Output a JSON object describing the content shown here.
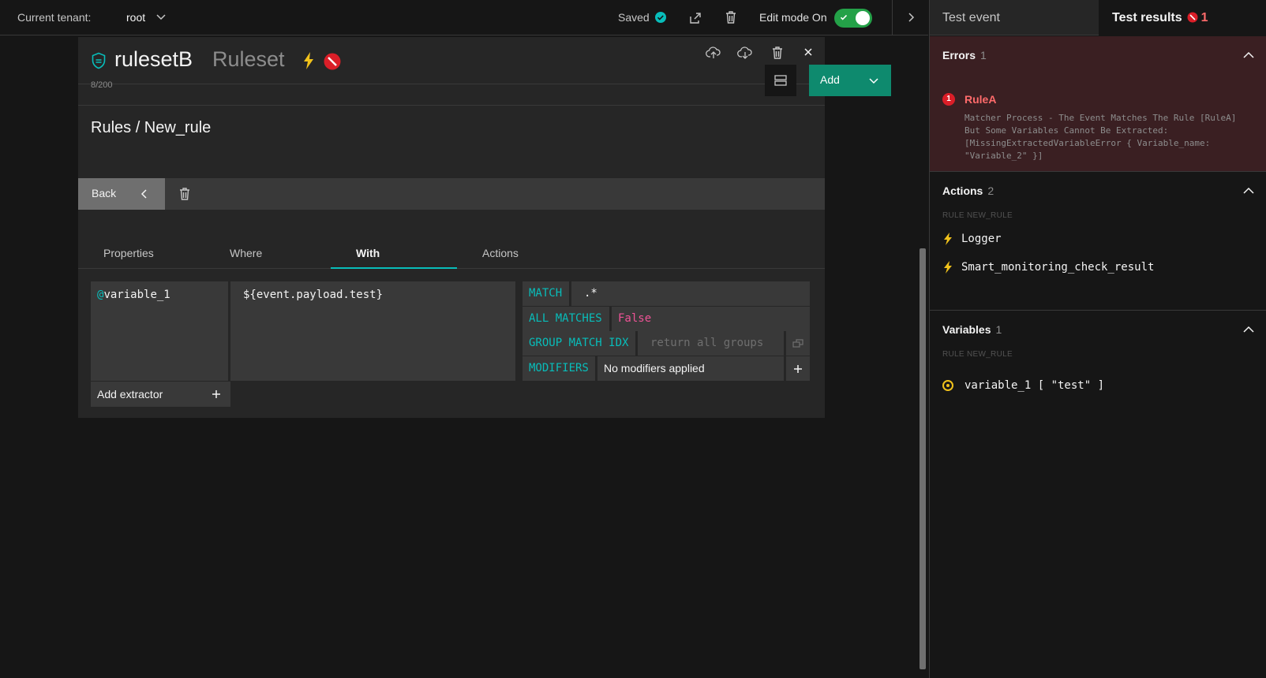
{
  "topbar": {
    "tenant_label": "Current tenant:",
    "tenant_value": "root",
    "saved_label": "Saved",
    "edit_mode_label": "Edit mode On"
  },
  "ruleset": {
    "name": "rulesetB",
    "type": "Ruleset",
    "counter": "8/200",
    "breadcrumb": "Rules / New_rule",
    "add_label": "Add",
    "back_label": "Back"
  },
  "tabs": [
    {
      "label": "Properties"
    },
    {
      "label": "Where"
    },
    {
      "label": "With"
    },
    {
      "label": "Actions"
    }
  ],
  "extractor": {
    "at_prefix": "@",
    "variable": "variable_1",
    "expression": "${event.payload.test}",
    "match_key": "MATCH",
    "match_value": ".*",
    "all_matches_key": "ALL MATCHES",
    "all_matches_value": "False",
    "group_idx_key": "GROUP MATCH IDX",
    "group_idx_placeholder": "return all groups",
    "modifiers_key": "MODIFIERS",
    "modifiers_value": "No modifiers applied",
    "add_extractor_label": "Add extractor"
  },
  "right_panel": {
    "tab_test_event": "Test event",
    "tab_test_results": "Test results",
    "results_error_count": "1",
    "errors": {
      "title": "Errors",
      "count": "1",
      "item_index": "1",
      "item_title": "RuleA",
      "item_message": "Matcher Process - The Event Matches The Rule [RuleA] But Some Variables Cannot Be Extracted: [MissingExtractedVariableError { Variable_name: \"Variable_2\" }]"
    },
    "actions": {
      "title": "Actions",
      "count": "2",
      "group_label": "RULE NEW_RULE",
      "items": [
        {
          "label": "Logger"
        },
        {
          "label": "Smart_monitoring_check_result"
        }
      ]
    },
    "variables": {
      "title": "Variables",
      "count": "1",
      "group_label": "RULE NEW_RULE",
      "item": "variable_1 [ \"test\" ]"
    }
  },
  "colors": {
    "accent_teal": "#08bdba",
    "add_green": "#0e8a6e",
    "error_red": "#da1e28",
    "bolt_yellow": "#f1c21b",
    "false_magenta": "#ee5396"
  }
}
